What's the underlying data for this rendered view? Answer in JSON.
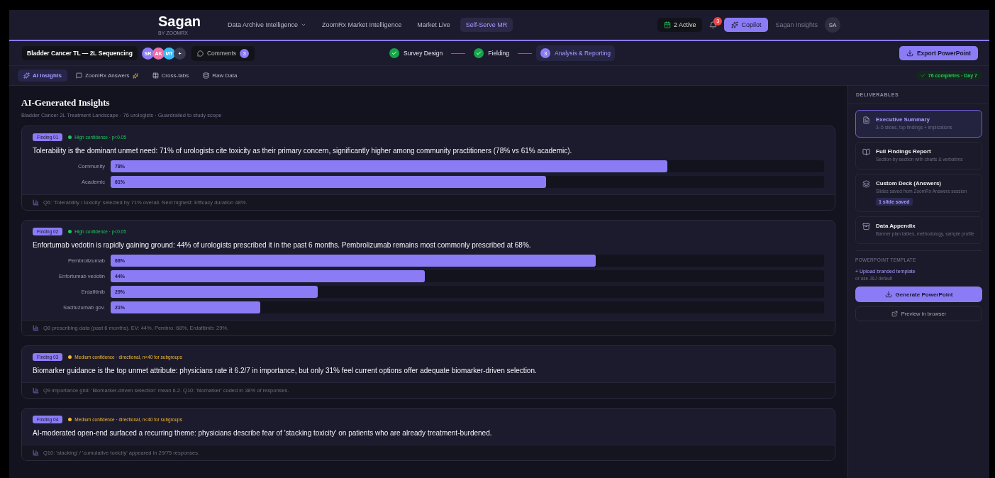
{
  "header": {
    "logo": "Sagan",
    "logo_sub": "BY ZOOMRX",
    "nav": [
      {
        "label": "Data Archive Intelligence",
        "dropdown": true,
        "selected": false
      },
      {
        "label": "ZoomRx Market Intelligence",
        "dropdown": false,
        "selected": false
      },
      {
        "label": "Market Live",
        "dropdown": false,
        "selected": false
      },
      {
        "label": "Self-Serve MR",
        "dropdown": false,
        "selected": true
      }
    ],
    "active": "2 Active",
    "notifications": "3",
    "copilot": "Copilot",
    "workspace": "Sagan Insights",
    "user_initials": "SA"
  },
  "project": {
    "title": "Bladder Cancer TL — 2L Sequencing",
    "collaborators": [
      {
        "initials": "SR",
        "color": "#8b7cf6"
      },
      {
        "initials": "AK",
        "color": "#ec6fa8"
      },
      {
        "initials": "MT",
        "color": "#38bdf8"
      },
      {
        "initials": "+",
        "color": "#3a3a4e"
      }
    ],
    "comments": "Comments",
    "comments_count": "3",
    "steps": [
      {
        "label": "Survey Design",
        "completed": true,
        "selected": false
      },
      {
        "label": "Fielding",
        "completed": true,
        "selected": false
      },
      {
        "label": "Analysis & Reporting",
        "number": "3",
        "completed": false,
        "selected": true
      }
    ],
    "export": "Export PowerPoint"
  },
  "tabs": [
    {
      "label": "AI Insights",
      "selected": true
    },
    {
      "label": "ZoomRx Answers",
      "selected": false
    },
    {
      "label": "Cross-tabs",
      "selected": false
    },
    {
      "label": "Raw Data",
      "selected": false
    }
  ],
  "status": "76 completes · Day 7",
  "insights": {
    "title": "AI-Generated Insights",
    "subtitle": "Bladder Cancer 2L Treatment Landscape · 76 urologists · Guardrailed to study scope",
    "findings": [
      {
        "tag": "Finding 01",
        "confidence": "High confidence · p<0.05",
        "color": "#22c55e",
        "text": "Tolerability is the dominant unmet need: 71% of urologists cite toxicity as their primary concern, significantly higher among community practitioners (78% vs 61% academic).",
        "bars": [
          {
            "label": "Community",
            "level": 0.78,
            "reading": "78%"
          },
          {
            "label": "Academic",
            "level": 0.61,
            "reading": "61%"
          }
        ],
        "source": "Q6: 'Tolerability / toxicity' selected by 71% overall. Next highest: Efficacy duration 48%."
      },
      {
        "tag": "Finding 02",
        "confidence": "High confidence · p<0.05",
        "color": "#22c55e",
        "text": "Enfortumab vedotin is rapidly gaining ground: 44% of urologists prescribed it in the past 6 months. Pembrolizumab remains most commonly prescribed at 68%.",
        "bars": [
          {
            "label": "Pembrolizumab",
            "level": 0.68,
            "reading": "68%"
          },
          {
            "label": "Enfortumab vedotin",
            "level": 0.44,
            "reading": "44%"
          },
          {
            "label": "Erdafitinib",
            "level": 0.29,
            "reading": "29%"
          },
          {
            "label": "Sacituzumab gov.",
            "level": 0.21,
            "reading": "21%"
          }
        ],
        "source": "Q8 prescribing data (past 6 months). EV: 44%, Pembro: 68%, Erdafitinib: 29%."
      },
      {
        "tag": "Finding 03",
        "confidence": "Medium confidence · directional, n<40 for subgroups",
        "color": "#f5b82e",
        "text": "Biomarker guidance is the top unmet attribute: physicians rate it 6.2/7 in importance, but only 31% feel current options offer adequate biomarker-driven selection.",
        "source": "Q9 importance grid: 'Biomarker-driven selection' mean 6.2. Q10: 'biomarker' coded in 38% of responses."
      },
      {
        "tag": "Finding 04",
        "confidence": "Medium confidence · directional, n<40 for subgroups",
        "color": "#f5b82e",
        "text": "AI-moderated open-end surfaced a recurring theme: physicians describe fear of 'stacking toxicity' on patients who are already treatment-burdened.",
        "source": "Q10: 'stacking' / 'cumulative toxicity' appeared in 29/75 responses."
      }
    ]
  },
  "deliverables": {
    "title": "DELIVERABLES",
    "items": [
      {
        "title": "Executive Summary",
        "description": "3–5 slides, top findings + implications",
        "selected": true
      },
      {
        "title": "Full Findings Report",
        "description": "Section-by-section with charts & verbatims",
        "selected": false
      },
      {
        "title": "Custom Deck (Answers)",
        "description": "Slides saved from ZoomRx Answers session",
        "badge": "1 slide saved",
        "selected": false
      },
      {
        "title": "Data Appendix",
        "description": "Banner plan tables, methodology, sample profile",
        "selected": false
      }
    ],
    "template_title": "POWERPOINT TEMPLATE",
    "upload": "+ Upload branded template",
    "default_note": "or use J&J default",
    "generate": "Generate PowerPoint",
    "preview": "Preview in browser"
  }
}
